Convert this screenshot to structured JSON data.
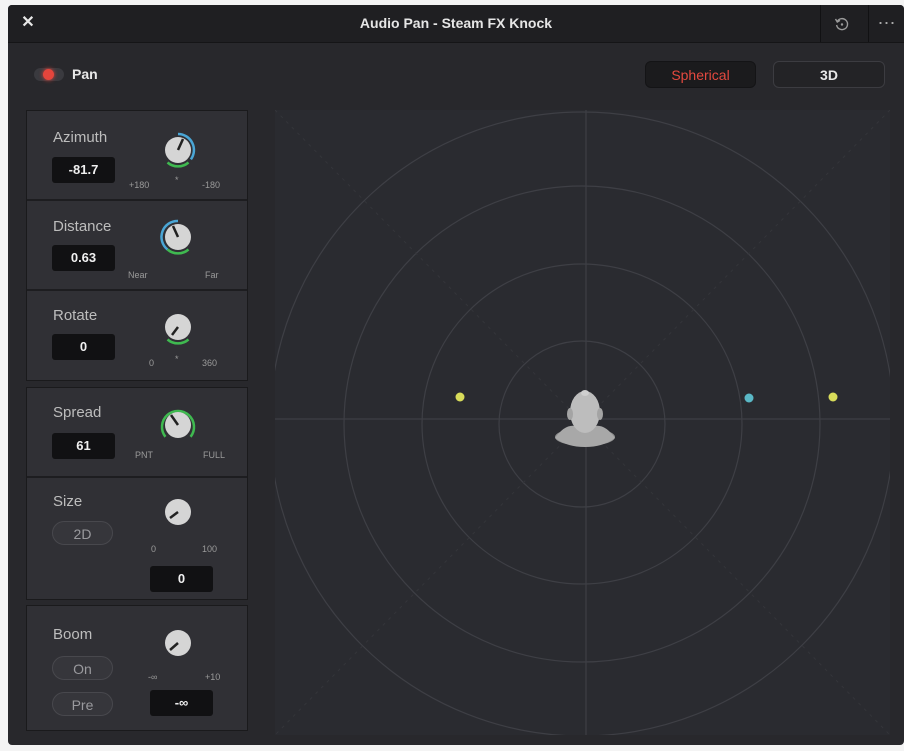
{
  "window": {
    "title": "Audio Pan - Steam FX Knock",
    "close_symbol": "✕",
    "more_symbol": "⋯"
  },
  "pan": {
    "label": "Pan",
    "enabled": true
  },
  "modes": {
    "spherical": "Spherical",
    "three_d": "3D",
    "active": "Spherical"
  },
  "controls": {
    "azimuth": {
      "label": "Azimuth",
      "value": "-81.7",
      "left": "+180",
      "center": "*",
      "right": "-180"
    },
    "distance": {
      "label": "Distance",
      "value": "0.63",
      "left": "Near",
      "right": "Far"
    },
    "rotate": {
      "label": "Rotate",
      "value": "0",
      "left": "0",
      "center": "*",
      "right": "360"
    },
    "spread": {
      "label": "Spread",
      "value": "61",
      "left": "PNT",
      "right": "FULL"
    },
    "size": {
      "label": "Size",
      "mode": "2D",
      "value": "0",
      "left": "0",
      "right": "100"
    },
    "boom": {
      "label": "Boom",
      "on": "On",
      "pre": "Pre",
      "value": "-∞",
      "left": "-∞",
      "right": "+10"
    }
  },
  "colors": {
    "accent_red": "#e5453c",
    "arc_blue": "#4aa6d6",
    "arc_green": "#3fb950",
    "dot_yellow": "#d8dc5a",
    "dot_cyan": "#5ab8c6"
  },
  "icons": {
    "reset": "reset-icon",
    "head": "listener-head-icon"
  }
}
